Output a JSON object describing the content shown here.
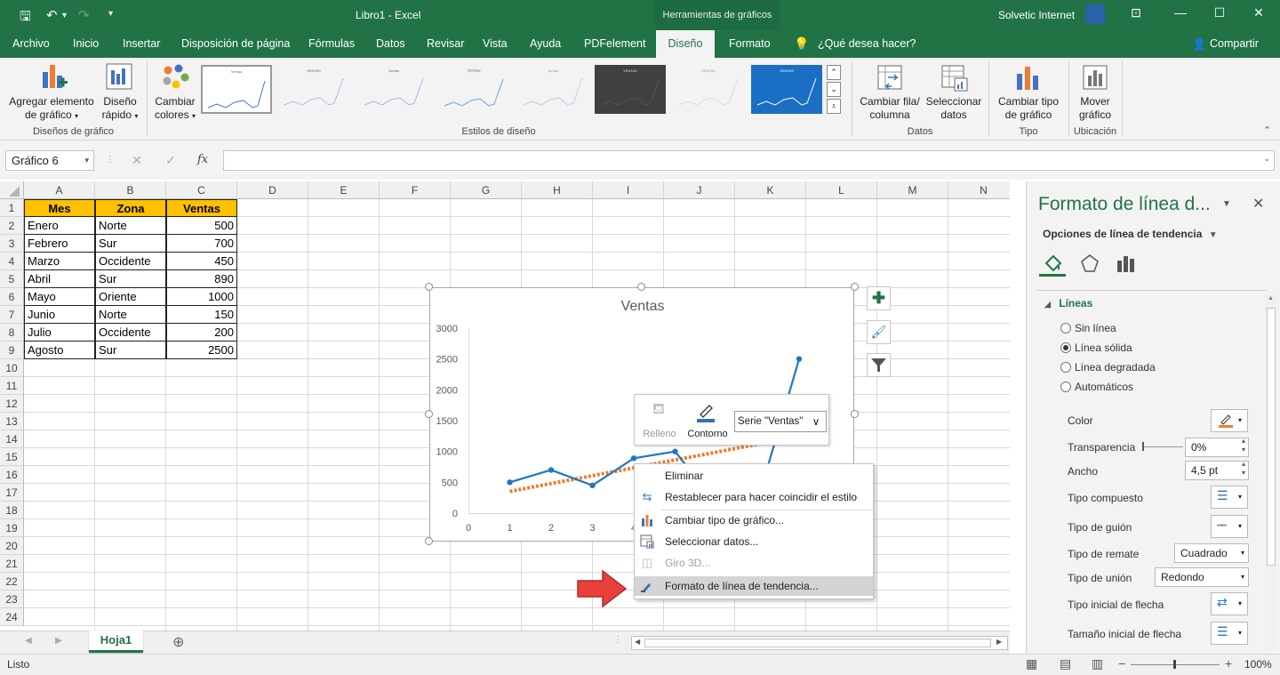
{
  "window": {
    "doc_title": "Libro1 - Excel",
    "tools_context": "Herramientas de gráficos",
    "user_name": "Solvetic Internet",
    "avatar_text": "",
    "quick_access": [
      "save-icon",
      "undo-icon",
      "redo-icon",
      "customize-icon"
    ]
  },
  "menu": {
    "tabs": [
      "Archivo",
      "Inicio",
      "Insertar",
      "Disposición de página",
      "Fórmulas",
      "Datos",
      "Revisar",
      "Vista",
      "Ayuda",
      "PDFelement",
      "Diseño",
      "Formato"
    ],
    "active_tab": "Diseño",
    "tell_me": "¿Qué desea hacer?",
    "share": "Compartir"
  },
  "ribbon": {
    "add_element_l1": "Agregar elemento",
    "add_element_l2": "de gráfico",
    "quick_layout_l1": "Diseño",
    "quick_layout_l2": "rápido",
    "group_layouts": "Diseños de gráfico",
    "change_colors_l1": "Cambiar",
    "change_colors_l2": "colores",
    "group_styles": "Estilos de diseño",
    "switch_row_l1": "Cambiar fila/",
    "switch_row_l2": "columna",
    "select_data_l1": "Seleccionar",
    "select_data_l2": "datos",
    "group_data": "Datos",
    "change_type_l1": "Cambiar tipo",
    "change_type_l2": "de gráfico",
    "group_type": "Tipo",
    "move_chart_l1": "Mover",
    "move_chart_l2": "gráfico",
    "group_location": "Ubicación",
    "style_thumb_titles": [
      "Ventas",
      "VENTAS",
      "Ventas",
      "Ventas",
      "Ventas",
      "VENTAS",
      "VENTAS"
    ]
  },
  "formula_bar": {
    "name_box": "Gráfico 6",
    "fx": "fx",
    "formula": ""
  },
  "sheet": {
    "columns": [
      "A",
      "B",
      "C",
      "D",
      "E",
      "F",
      "G",
      "H",
      "I",
      "J",
      "K",
      "L",
      "M",
      "N"
    ],
    "rows": [
      "1",
      "2",
      "3",
      "4",
      "5",
      "6",
      "7",
      "8",
      "9",
      "10",
      "11",
      "12",
      "13",
      "14",
      "15",
      "16",
      "17",
      "18",
      "19",
      "20",
      "21",
      "22",
      "23",
      "24"
    ],
    "headers": [
      "Mes",
      "Zona",
      "Ventas"
    ],
    "data": [
      [
        "Enero",
        "Norte",
        "500"
      ],
      [
        "Febrero",
        "Sur",
        "700"
      ],
      [
        "Marzo",
        "Occidente",
        "450"
      ],
      [
        "Abril",
        "Sur",
        "890"
      ],
      [
        "Mayo",
        "Oriente",
        "1000"
      ],
      [
        "Junio",
        "Norte",
        "150"
      ],
      [
        "Julio",
        "Occidente",
        "200"
      ],
      [
        "Agosto",
        "Sur",
        "2500"
      ]
    ],
    "tab": "Hoja1"
  },
  "chart_data": {
    "type": "line",
    "title": "Ventas",
    "x": [
      1,
      2,
      3,
      4,
      5,
      6,
      7,
      8
    ],
    "series": [
      {
        "values": [
          500,
          700,
          450,
          890,
          1000,
          150,
          200,
          2500
        ]
      }
    ],
    "trendline": "linear",
    "y_ticks": [
      "0",
      "500",
      "1000",
      "1500",
      "2000",
      "2500",
      "3000"
    ],
    "x_ticks": [
      "0",
      "1",
      "2",
      "3",
      "4"
    ],
    "ylim": [
      0,
      3000
    ],
    "line_color": "#1f77c4",
    "trend_color": "#ed7d31"
  },
  "format_popup": {
    "fill": "Relleno",
    "outline": "Contorno",
    "series_select": "Serie \"Ventas\" |"
  },
  "context_menu": [
    {
      "label": "Eliminar",
      "icon": "",
      "disabled": false,
      "highlight": false
    },
    {
      "label": "Restablecer para hacer coincidir el estilo",
      "icon": "reset-style-icon",
      "disabled": false,
      "highlight": false
    },
    {
      "label": "Cambiar tipo de gráfico...",
      "icon": "chart-type-icon",
      "disabled": false,
      "highlight": false
    },
    {
      "label": "Seleccionar datos...",
      "icon": "select-data-icon",
      "disabled": false,
      "highlight": false
    },
    {
      "label": "Giro 3D...",
      "icon": "rotation-icon",
      "disabled": true,
      "highlight": false
    },
    {
      "label": "Formato de línea de tendencia...",
      "icon": "format-trendline-icon",
      "disabled": false,
      "highlight": true
    }
  ],
  "pane": {
    "title": "Formato de línea d...",
    "options": "Opciones de línea de tendencia",
    "section": "Líneas",
    "radios": [
      "Sin línea",
      "Línea sólida",
      "Línea degradada",
      "Automáticos"
    ],
    "selected_radio": 1,
    "color": "Color",
    "transparency": "Transparencia",
    "transparency_value": "0%",
    "width": "Ancho",
    "width_value": "4,5 pt",
    "compound": "Tipo compuesto",
    "dash": "Tipo de guión",
    "cap": "Tipo de remate",
    "cap_value": "Cuadrado",
    "join": "Tipo de unión",
    "join_value": "Redondo",
    "arrow_start": "Tipo inicial de flecha",
    "arrow_size": "Tamaño inicial de flecha"
  },
  "status": {
    "text": "Listo",
    "zoom": "100%"
  }
}
